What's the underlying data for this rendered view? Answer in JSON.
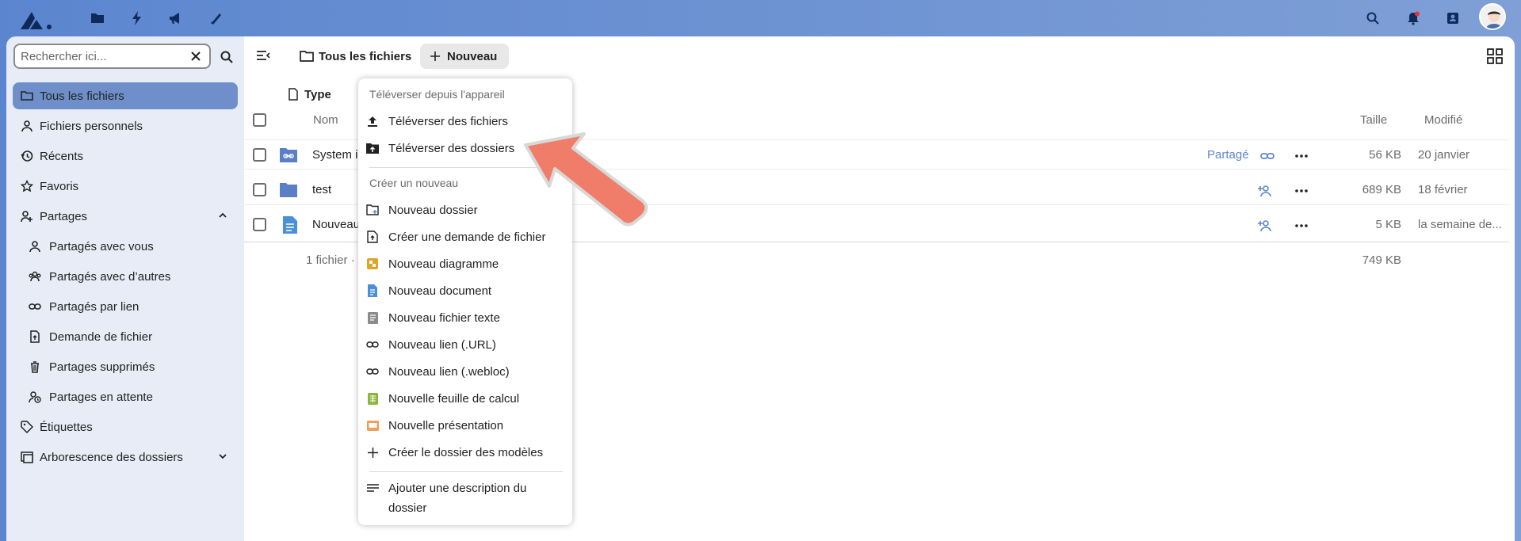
{
  "colors": {
    "accent": "#5b86cf",
    "active_nav": "#6f8fcb",
    "header_bg": "#6a8fd0",
    "annotation_arrow": "#f07d6a"
  },
  "topbar": {
    "app_icons": [
      "files-icon",
      "activity-icon",
      "announcements-icon",
      "notes-icon"
    ],
    "right_icons": [
      "search-icon",
      "notifications-icon",
      "contacts-icon"
    ],
    "avatar": "user-avatar"
  },
  "sidebar": {
    "search": {
      "placeholder": "Rechercher ici..."
    },
    "items": [
      {
        "label": "Tous les fichiers",
        "icon": "folder-icon"
      },
      {
        "label": "Fichiers personnels",
        "icon": "user-icon"
      },
      {
        "label": "Récents",
        "icon": "history-icon"
      },
      {
        "label": "Favoris",
        "icon": "star-icon"
      },
      {
        "label": "Partages",
        "icon": "share-icon"
      },
      {
        "label": "Partagés avec vous",
        "icon": "user-icon"
      },
      {
        "label": "Partagés avec d’autres",
        "icon": "group-icon"
      },
      {
        "label": "Partagés par lien",
        "icon": "link-icon"
      },
      {
        "label": "Demande de fichier",
        "icon": "file-upload-icon"
      },
      {
        "label": "Partages supprimés",
        "icon": "trash-icon"
      },
      {
        "label": "Partages en attente",
        "icon": "pending-icon"
      },
      {
        "label": "Étiquettes",
        "icon": "tag-icon"
      },
      {
        "label": "Arborescence des dossiers",
        "icon": "folder-tree-icon"
      }
    ]
  },
  "main": {
    "breadcrumb": "Tous les fichiers",
    "new_button": "Nouveau",
    "filter_type": "Type",
    "columns": {
      "name": "Nom",
      "size": "Taille",
      "modified": "Modifié"
    },
    "rows": [
      {
        "name": "System i",
        "shared_label": "Partagé",
        "size": "56 KB",
        "modified": "20 janvier"
      },
      {
        "name": "test",
        "shared_label": "",
        "size": "689 KB",
        "modified": "18 février"
      },
      {
        "name": "Nouveau",
        "shared_label": "",
        "size": "5 KB",
        "modified": "la semaine de..."
      }
    ],
    "summary": {
      "count": "1 fichier ·",
      "total": "749 KB"
    }
  },
  "menu": {
    "caption_upload": "Téléverser depuis l'appareil",
    "upload_files": "Téléverser des fichiers",
    "upload_folders": "Téléverser des dossiers",
    "caption_create": "Créer un nouveau",
    "new_folder": "Nouveau dossier",
    "file_request": "Créer une demande de fichier",
    "new_diagram": "Nouveau diagramme",
    "new_document": "Nouveau document",
    "new_text": "Nouveau fichier texte",
    "new_link_url": "Nouveau lien (.URL)",
    "new_link_webloc": "Nouveau lien (.webloc)",
    "new_spreadsheet": "Nouvelle feuille de calcul",
    "new_presentation": "Nouvelle présentation",
    "templates_folder": "Créer le dossier des modèles",
    "add_description_1": "Ajouter une description du",
    "add_description_2": "dossier"
  }
}
